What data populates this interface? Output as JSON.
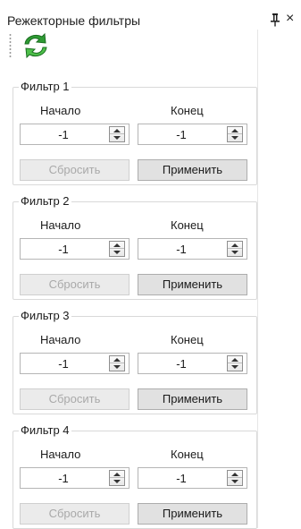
{
  "panel": {
    "title": "Режекторные фильтры",
    "pin_glyph": "pin-icon",
    "close_glyph": "×"
  },
  "toolbar": {
    "refresh_icon": "refresh-icon",
    "refresh_colors": [
      "#1f8f2a",
      "#5cc85a"
    ]
  },
  "filters": [
    {
      "legend": "Фильтр 1",
      "start_label": "Начало",
      "end_label": "Конец",
      "start_value": "-1",
      "end_value": "-1",
      "reset_label": "Сбросить",
      "apply_label": "Применить",
      "reset_enabled": false
    },
    {
      "legend": "Фильтр 2",
      "start_label": "Начало",
      "end_label": "Конец",
      "start_value": "-1",
      "end_value": "-1",
      "reset_label": "Сбросить",
      "apply_label": "Применить",
      "reset_enabled": false
    },
    {
      "legend": "Фильтр 3",
      "start_label": "Начало",
      "end_label": "Конец",
      "start_value": "-1",
      "end_value": "-1",
      "reset_label": "Сбросить",
      "apply_label": "Применить",
      "reset_enabled": false
    },
    {
      "legend": "Фильтр 4",
      "start_label": "Начало",
      "end_label": "Конец",
      "start_value": "-1",
      "end_value": "-1",
      "reset_label": "Сбросить",
      "apply_label": "Применить",
      "reset_enabled": false
    }
  ]
}
